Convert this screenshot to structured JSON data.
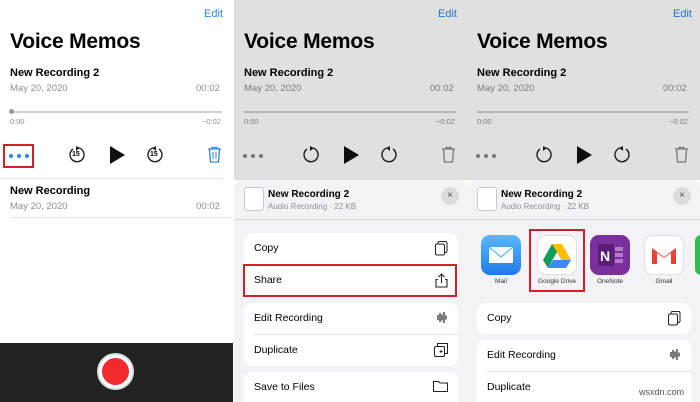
{
  "app": {
    "edit_label": "Edit",
    "title": "Voice Memos"
  },
  "recording_primary": {
    "name": "New Recording 2",
    "date": "May 20, 2020",
    "duration": "00:02",
    "elapsed": "0:00",
    "remaining": "−0:02"
  },
  "recording_secondary": {
    "name": "New Recording",
    "date": "May 20, 2020",
    "duration": "00:02"
  },
  "controls": {
    "skip_back_seconds": "15",
    "skip_forward_seconds": "15"
  },
  "share_sheet": {
    "file_name": "New Recording 2",
    "file_sub": "Audio Recording · 22 KB",
    "close": "×"
  },
  "actions_panel2": [
    "Copy",
    "Share",
    "Edit Recording",
    "Duplicate",
    "Save to Files"
  ],
  "apps_panel3": [
    {
      "label": "Mail",
      "color": "#2b8ff5"
    },
    {
      "label": "Google Drive",
      "color": "#ffffff"
    },
    {
      "label": "OneNote",
      "color": "#7b2f9e"
    },
    {
      "label": "Gmail",
      "color": "#ffffff"
    }
  ],
  "actions_panel3": [
    "Copy",
    "Edit Recording",
    "Duplicate"
  ],
  "watermark": "wsxdn.com",
  "colors": {
    "accent": "#2e86de",
    "record": "#f12b2b",
    "highlight": "#d0202a"
  }
}
